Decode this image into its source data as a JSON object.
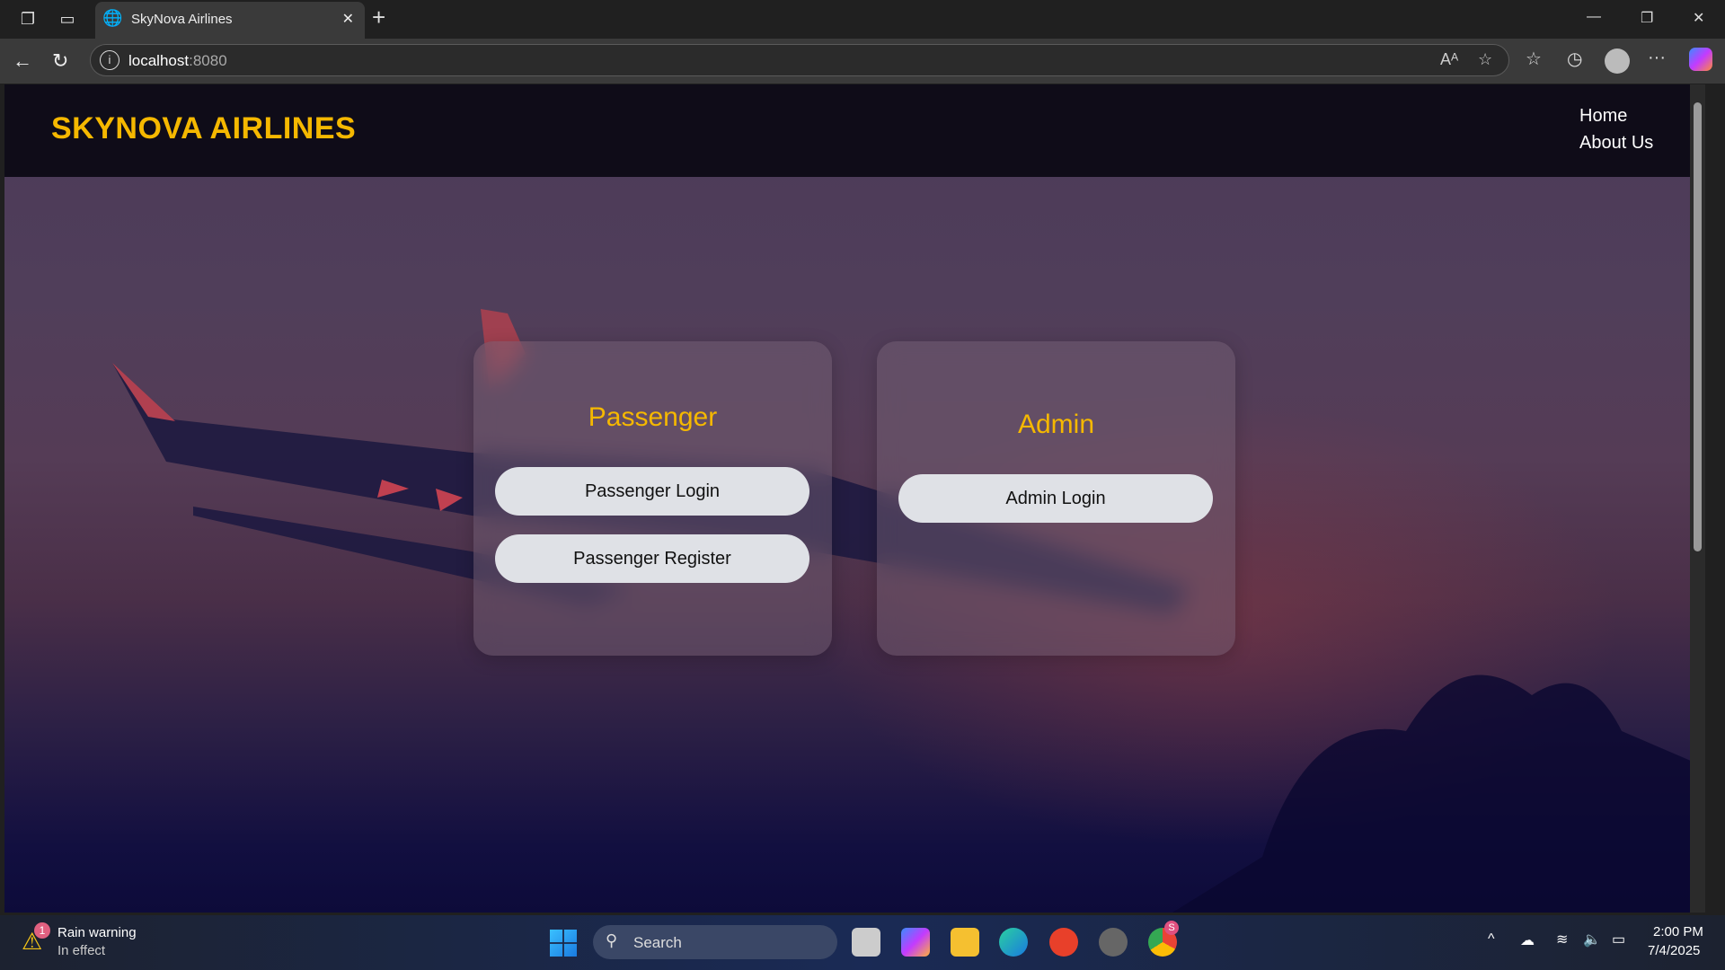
{
  "browser": {
    "tab_title": "SkyNova Airlines",
    "url_host": "localhost",
    "url_port": ":8080"
  },
  "site": {
    "logo": "SKYNOVA AIRLINES",
    "nav": [
      "Home",
      "About Us"
    ]
  },
  "passenger_card": {
    "title": "Passenger",
    "login": "Passenger Login",
    "register": "Passenger Register"
  },
  "admin_card": {
    "title": "Admin",
    "login": "Admin Login"
  },
  "taskbar": {
    "weather_title": "Rain warning",
    "weather_sub": "In effect",
    "weather_badge": "1",
    "search": "Search",
    "time": "2:00 PM",
    "date": "7/4/2025",
    "chrome_badge": "S"
  },
  "colors": {
    "accent": "#f5b800",
    "header_bg": "#0f0c18"
  }
}
